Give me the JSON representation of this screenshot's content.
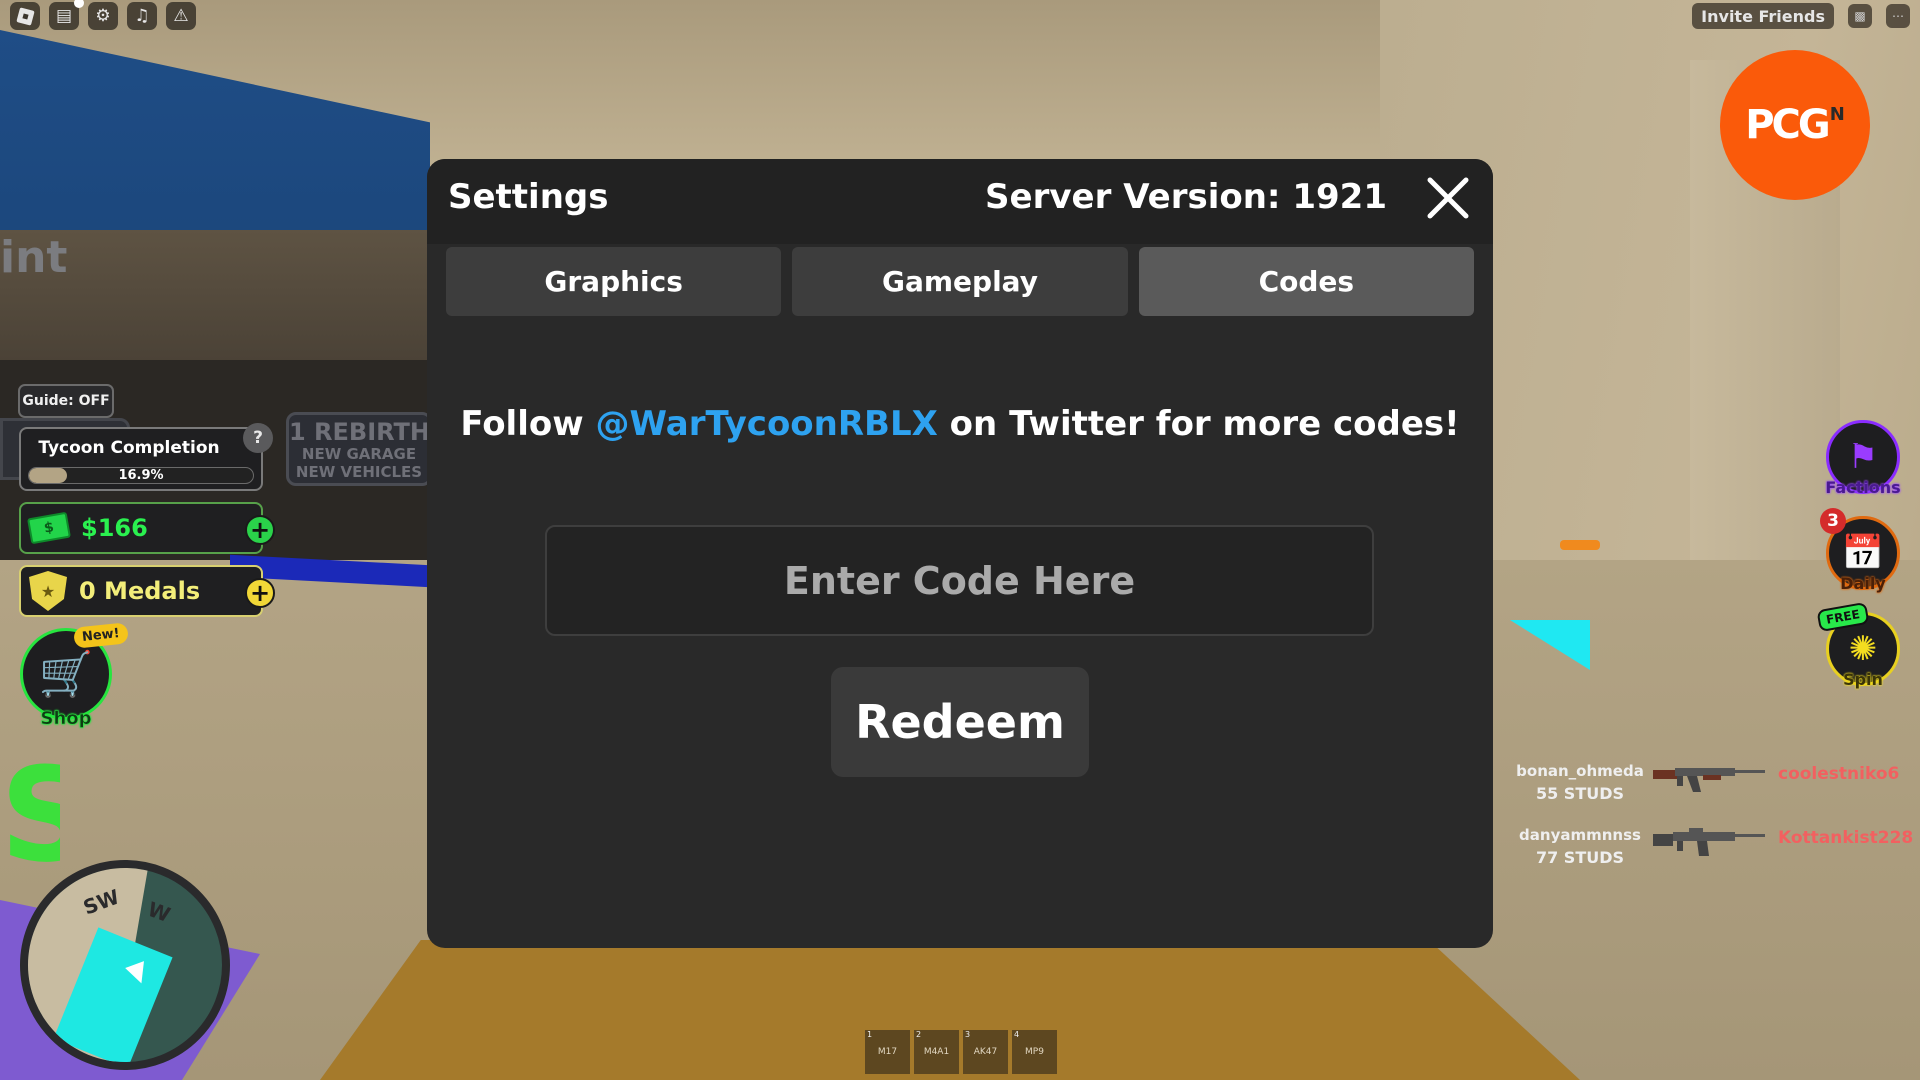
{
  "modal": {
    "title": "Settings",
    "server_version": "Server Version: 1921",
    "close_icon": "close-icon",
    "tabs": [
      {
        "label": "Graphics",
        "active": false
      },
      {
        "label": "Gameplay",
        "active": false
      },
      {
        "label": "Codes",
        "active": true
      }
    ],
    "follow_prefix": "Follow ",
    "follow_handle": "@WarTycoonRBLX",
    "follow_suffix": " on Twitter for more codes!",
    "code_input": {
      "value": "",
      "placeholder": "Enter Code Here"
    },
    "redeem_label": "Redeem",
    "colors": {
      "handle": "#2ea2f0",
      "panel": "#292929",
      "header": "#222222"
    }
  },
  "topbar_left": {
    "icons": [
      "roblox-menu-icon",
      "chat-icon",
      "settings-gear-icon",
      "music-icon",
      "warning-icon"
    ]
  },
  "topbar_right": {
    "invite_label": "Invite Friends",
    "icons": [
      "leaderboard-icon",
      "more-options-icon"
    ]
  },
  "watermark": {
    "text": "PCG",
    "superscript": "N",
    "color": "#fa5a0a"
  },
  "hud_left": {
    "guide_label": "Guide: OFF",
    "tycoon": {
      "title": "Tycoon Completion",
      "help": "?",
      "progress_percent": 16.9,
      "progress_label": "16.9%"
    },
    "cash": {
      "value": "$166",
      "plus": "+"
    },
    "medals": {
      "value": "0 Medals",
      "plus": "+"
    },
    "shop": {
      "label": "Shop",
      "badge": "New!"
    },
    "minimap": {
      "directions": [
        "SW",
        "W"
      ]
    }
  },
  "scene_signs": {
    "partial_text": "int",
    "rebirth_title": "1 REBIRTH",
    "rebirth_line1": "NEW GARAGE",
    "rebirth_line2": "NEW VEHICLES"
  },
  "hud_right": {
    "buttons": [
      {
        "label": "Factions",
        "icon": "banner-icon",
        "color": "#8a2cff"
      },
      {
        "label": "Daily",
        "icon": "calendar-icon",
        "badge": "3",
        "color": "#e06a10"
      },
      {
        "label": "Spin",
        "icon": "wheel-icon",
        "badge": "FREE",
        "color": "#e8d020"
      }
    ]
  },
  "killfeed": [
    {
      "killer": "bonan_ohmeda",
      "distance": "55 STUDS",
      "weapon": "AK47",
      "victim": "coolestniko6"
    },
    {
      "killer": "danyammnnss",
      "distance": "77 STUDS",
      "weapon": "M4A1",
      "victim": "Kottankist228"
    }
  ],
  "hotbar": [
    {
      "slot": "1",
      "label": "M17"
    },
    {
      "slot": "2",
      "label": "M4A1"
    },
    {
      "slot": "3",
      "label": "AK47"
    },
    {
      "slot": "4",
      "label": "MP9"
    }
  ]
}
